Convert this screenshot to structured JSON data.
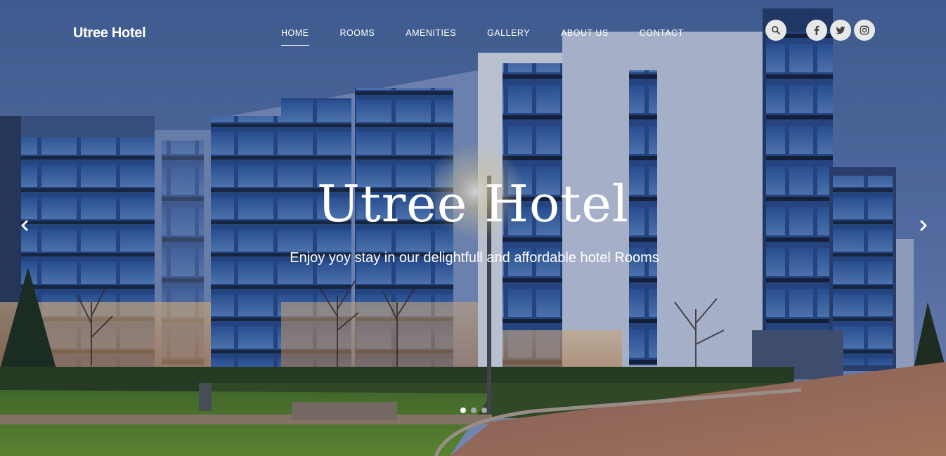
{
  "brand": {
    "name": "Utree Hotel"
  },
  "nav": {
    "items": [
      {
        "label": "HOME",
        "active": true
      },
      {
        "label": "ROOMS",
        "active": false
      },
      {
        "label": "AMENITIES",
        "active": false
      },
      {
        "label": "GALLERY",
        "active": false
      },
      {
        "label": "ABOUT US",
        "active": false
      },
      {
        "label": "CONTACT",
        "active": false
      }
    ]
  },
  "header_icons": [
    "search-icon",
    "facebook-icon",
    "twitter-icon",
    "instagram-icon"
  ],
  "hero": {
    "title": "Utree Hotel",
    "subtitle": "Enjoy yoy stay in our delightfull and affordable hotel Rooms"
  },
  "carousel": {
    "slide_count": 3,
    "active_slide": 1
  },
  "colors": {
    "text": "#ffffff",
    "icon_bg": "#e8e8e8",
    "sky": "#5a7ab4",
    "lawn": "#4f7a2c",
    "pavement": "#b07960"
  }
}
